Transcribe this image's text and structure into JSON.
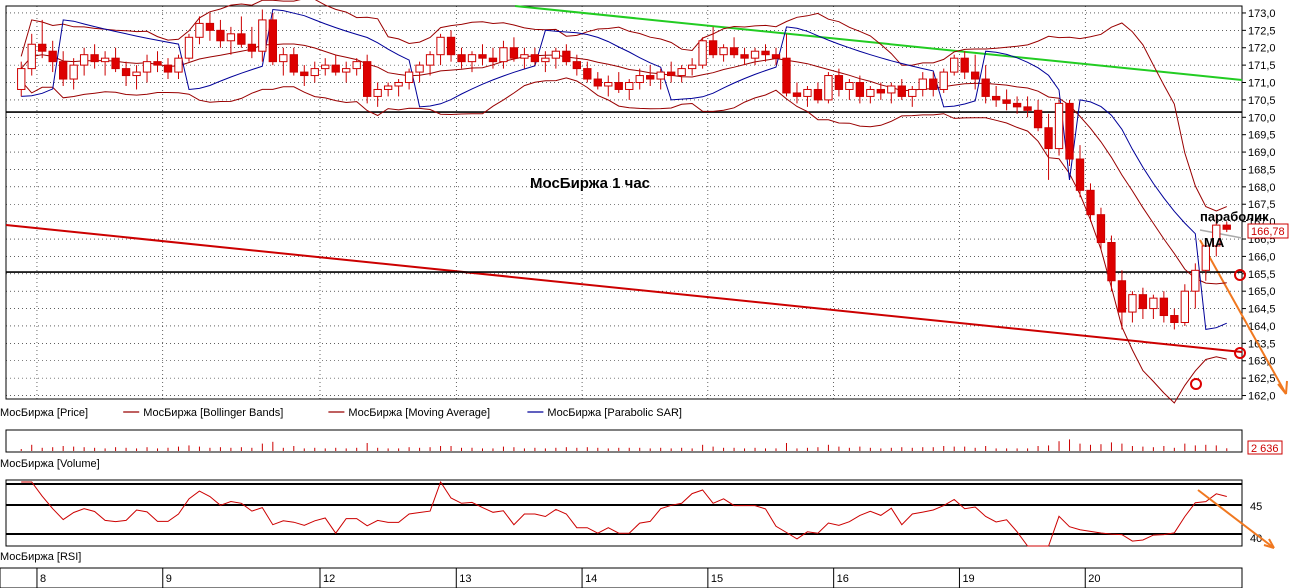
{
  "chart_data": {
    "type": "candlestick",
    "title": "МосБиржа   1 час",
    "price_panel": {
      "ylim": [
        161.9,
        173.2
      ],
      "y_ticks": [
        "173,0",
        "172,5",
        "172,0",
        "171,5",
        "171,0",
        "170,5",
        "170,0",
        "169,5",
        "169,0",
        "168,5",
        "168,0",
        "167,5",
        "167,0",
        "166,5",
        "166,0",
        "165,5",
        "165,0",
        "164,5",
        "164,0",
        "163,5",
        "163,0",
        "162,5",
        "162,0"
      ],
      "last_price_label": "166,78",
      "last_price": 166.78,
      "horizontal_levels": [
        170.15,
        165.55
      ],
      "candles": [
        [
          170.8,
          171.6,
          170.6,
          171.4
        ],
        [
          171.4,
          172.4,
          171.2,
          172.1
        ],
        [
          172.1,
          172.8,
          171.7,
          171.9
        ],
        [
          171.9,
          172.2,
          171.3,
          171.6
        ],
        [
          171.6,
          171.9,
          170.9,
          171.1
        ],
        [
          171.1,
          171.7,
          170.8,
          171.5
        ],
        [
          171.5,
          172.0,
          171.2,
          171.8
        ],
        [
          171.8,
          172.1,
          171.4,
          171.6
        ],
        [
          171.6,
          171.9,
          171.2,
          171.7
        ],
        [
          171.7,
          172.0,
          171.3,
          171.4
        ],
        [
          171.4,
          171.6,
          170.9,
          171.2
        ],
        [
          171.2,
          171.5,
          170.8,
          171.3
        ],
        [
          171.3,
          171.8,
          171.0,
          171.6
        ],
        [
          171.6,
          171.9,
          171.3,
          171.5
        ],
        [
          171.5,
          171.7,
          171.1,
          171.3
        ],
        [
          171.3,
          171.8,
          171.1,
          171.7
        ],
        [
          171.7,
          172.4,
          171.6,
          172.3
        ],
        [
          172.3,
          172.9,
          172.1,
          172.7
        ],
        [
          172.7,
          173.0,
          172.2,
          172.5
        ],
        [
          172.5,
          172.8,
          172.0,
          172.2
        ],
        [
          172.2,
          172.6,
          171.8,
          172.4
        ],
        [
          172.4,
          172.9,
          172.0,
          172.1
        ],
        [
          172.1,
          172.6,
          171.7,
          171.9
        ],
        [
          171.9,
          173.1,
          171.6,
          172.8
        ],
        [
          172.8,
          173.0,
          171.5,
          171.6
        ],
        [
          171.6,
          172.0,
          171.2,
          171.8
        ],
        [
          171.8,
          172.0,
          171.2,
          171.3
        ],
        [
          171.3,
          171.5,
          170.9,
          171.2
        ],
        [
          171.2,
          171.6,
          171.0,
          171.4
        ],
        [
          171.4,
          171.7,
          171.2,
          171.5
        ],
        [
          171.5,
          171.8,
          171.2,
          171.3
        ],
        [
          171.3,
          171.6,
          171.0,
          171.4
        ],
        [
          171.4,
          171.7,
          171.2,
          171.6
        ],
        [
          171.6,
          171.8,
          170.4,
          170.6
        ],
        [
          170.6,
          171.0,
          170.3,
          170.8
        ],
        [
          170.8,
          171.0,
          170.6,
          170.9
        ],
        [
          170.9,
          171.1,
          170.6,
          171.0
        ],
        [
          171.0,
          171.4,
          170.8,
          171.3
        ],
        [
          171.3,
          171.6,
          171.0,
          171.5
        ],
        [
          171.5,
          171.9,
          171.2,
          171.8
        ],
        [
          171.8,
          172.4,
          171.5,
          172.3
        ],
        [
          172.3,
          172.5,
          171.6,
          171.8
        ],
        [
          171.8,
          172.0,
          171.4,
          171.6
        ],
        [
          171.6,
          171.9,
          171.3,
          171.8
        ],
        [
          171.8,
          172.1,
          171.5,
          171.7
        ],
        [
          171.7,
          172.0,
          171.4,
          171.6
        ],
        [
          171.6,
          172.2,
          171.4,
          172.0
        ],
        [
          172.0,
          172.3,
          171.6,
          171.7
        ],
        [
          171.7,
          172.0,
          171.4,
          171.8
        ],
        [
          171.8,
          172.0,
          171.5,
          171.6
        ],
        [
          171.6,
          171.9,
          171.3,
          171.7
        ],
        [
          171.7,
          172.0,
          171.4,
          171.9
        ],
        [
          171.9,
          172.1,
          171.5,
          171.6
        ],
        [
          171.6,
          171.8,
          171.2,
          171.4
        ],
        [
          171.4,
          171.6,
          171.0,
          171.1
        ],
        [
          171.1,
          171.3,
          170.8,
          170.9
        ],
        [
          170.9,
          171.2,
          170.6,
          171.0
        ],
        [
          171.0,
          171.3,
          170.7,
          170.8
        ],
        [
          170.8,
          171.1,
          170.5,
          171.0
        ],
        [
          171.0,
          171.4,
          170.8,
          171.2
        ],
        [
          171.2,
          171.5,
          170.9,
          171.1
        ],
        [
          171.1,
          171.4,
          170.8,
          171.3
        ],
        [
          171.3,
          171.6,
          171.0,
          171.2
        ],
        [
          171.2,
          171.5,
          171.0,
          171.4
        ],
        [
          171.4,
          171.7,
          171.2,
          171.5
        ],
        [
          171.5,
          172.3,
          171.4,
          172.2
        ],
        [
          172.2,
          172.6,
          171.7,
          171.8
        ],
        [
          171.8,
          172.1,
          171.6,
          172.0
        ],
        [
          172.0,
          172.3,
          171.7,
          171.8
        ],
        [
          171.8,
          172.0,
          171.5,
          171.7
        ],
        [
          171.7,
          172.0,
          171.5,
          171.9
        ],
        [
          171.9,
          172.1,
          171.6,
          171.8
        ],
        [
          171.8,
          172.0,
          171.5,
          171.7
        ],
        [
          171.7,
          172.4,
          170.6,
          170.7
        ],
        [
          170.7,
          171.0,
          170.4,
          170.6
        ],
        [
          170.6,
          170.9,
          170.3,
          170.8
        ],
        [
          170.8,
          171.0,
          170.4,
          170.5
        ],
        [
          170.5,
          171.3,
          170.4,
          171.2
        ],
        [
          171.2,
          171.4,
          170.6,
          170.8
        ],
        [
          170.8,
          171.1,
          170.5,
          171.0
        ],
        [
          171.0,
          171.2,
          170.4,
          170.6
        ],
        [
          170.6,
          170.9,
          170.4,
          170.8
        ],
        [
          170.8,
          171.0,
          170.5,
          170.7
        ],
        [
          170.7,
          171.0,
          170.4,
          170.9
        ],
        [
          170.9,
          171.1,
          170.5,
          170.6
        ],
        [
          170.6,
          170.9,
          170.3,
          170.8
        ],
        [
          170.8,
          171.3,
          170.6,
          171.1
        ],
        [
          171.1,
          171.3,
          170.6,
          170.8
        ],
        [
          170.8,
          171.4,
          170.7,
          171.3
        ],
        [
          171.3,
          171.8,
          171.2,
          171.7
        ],
        [
          171.7,
          171.9,
          171.1,
          171.3
        ],
        [
          171.3,
          171.8,
          170.8,
          171.1
        ],
        [
          171.1,
          171.5,
          170.4,
          170.6
        ],
        [
          170.6,
          170.9,
          170.3,
          170.5
        ],
        [
          170.5,
          170.8,
          170.2,
          170.4
        ],
        [
          170.4,
          170.6,
          170.1,
          170.3
        ],
        [
          170.3,
          170.6,
          170.0,
          170.2
        ],
        [
          170.2,
          170.5,
          169.6,
          169.7
        ],
        [
          169.7,
          170.1,
          168.2,
          169.1
        ],
        [
          169.1,
          170.5,
          168.9,
          170.4
        ],
        [
          170.4,
          170.5,
          168.6,
          168.8
        ],
        [
          168.8,
          169.2,
          167.7,
          167.9
        ],
        [
          167.9,
          168.1,
          167.0,
          167.2
        ],
        [
          167.2,
          167.4,
          166.2,
          166.4
        ],
        [
          166.4,
          166.6,
          165.0,
          165.3
        ],
        [
          165.3,
          165.6,
          163.9,
          164.4
        ],
        [
          164.4,
          165.0,
          164.1,
          164.9
        ],
        [
          164.9,
          165.1,
          164.2,
          164.5
        ],
        [
          164.5,
          164.9,
          164.2,
          164.8
        ],
        [
          164.8,
          165.0,
          164.1,
          164.3
        ],
        [
          164.3,
          164.5,
          163.9,
          164.1
        ],
        [
          164.1,
          165.2,
          164.0,
          165.0
        ],
        [
          165.0,
          165.8,
          164.5,
          165.6
        ],
        [
          165.6,
          166.4,
          165.3,
          166.3
        ],
        [
          166.3,
          167.2,
          166.0,
          166.9
        ],
        [
          166.9,
          167.0,
          166.7,
          166.78
        ]
      ]
    },
    "x_axis": {
      "day_labels": [
        "8",
        "9",
        "12",
        "13",
        "14",
        "15",
        "16",
        "19",
        "20"
      ],
      "day_start_index": [
        2,
        14,
        29,
        42,
        54,
        66,
        78,
        90,
        102
      ]
    },
    "legend": [
      {
        "name": "МосБиржа [Price]",
        "color": "#cc0000"
      },
      {
        "name": "МосБиржа [Bollinger Bands]",
        "color": "#990000"
      },
      {
        "name": "МосБиржа [Moving Average]",
        "color": "#990000"
      },
      {
        "name": "МосБиржа [Parabolic SAR]",
        "color": "#000099"
      }
    ],
    "annotations": {
      "parabolic": "параболик",
      "ma": "МА"
    },
    "volume_panel": {
      "title": "МосБиржа [Volume]",
      "last_value_label": "2 636"
    },
    "rsi_panel": {
      "title": "МосБиржа [RSI]",
      "y_ticks": [
        "45",
        "40"
      ]
    }
  }
}
